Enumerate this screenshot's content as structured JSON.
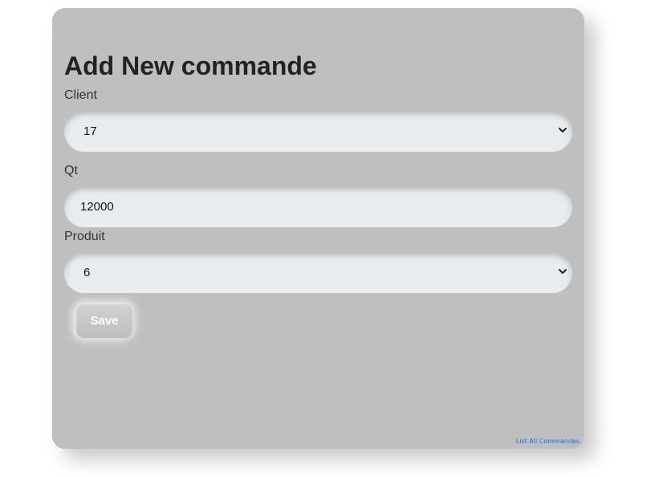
{
  "form": {
    "title": "Add New commande",
    "client": {
      "label": "Client",
      "value": "17"
    },
    "qt": {
      "label": "Qt",
      "value": "12000"
    },
    "produit": {
      "label": "Produit",
      "value": "6"
    },
    "save_label": "Save",
    "list_link": "List All Commandes"
  },
  "colors": {
    "card_background": "#bfbfbf",
    "field_background": "#e9ecef",
    "link": "#1a6cf2"
  },
  "icons": {
    "select_arrow": "chevron-down-icon"
  }
}
